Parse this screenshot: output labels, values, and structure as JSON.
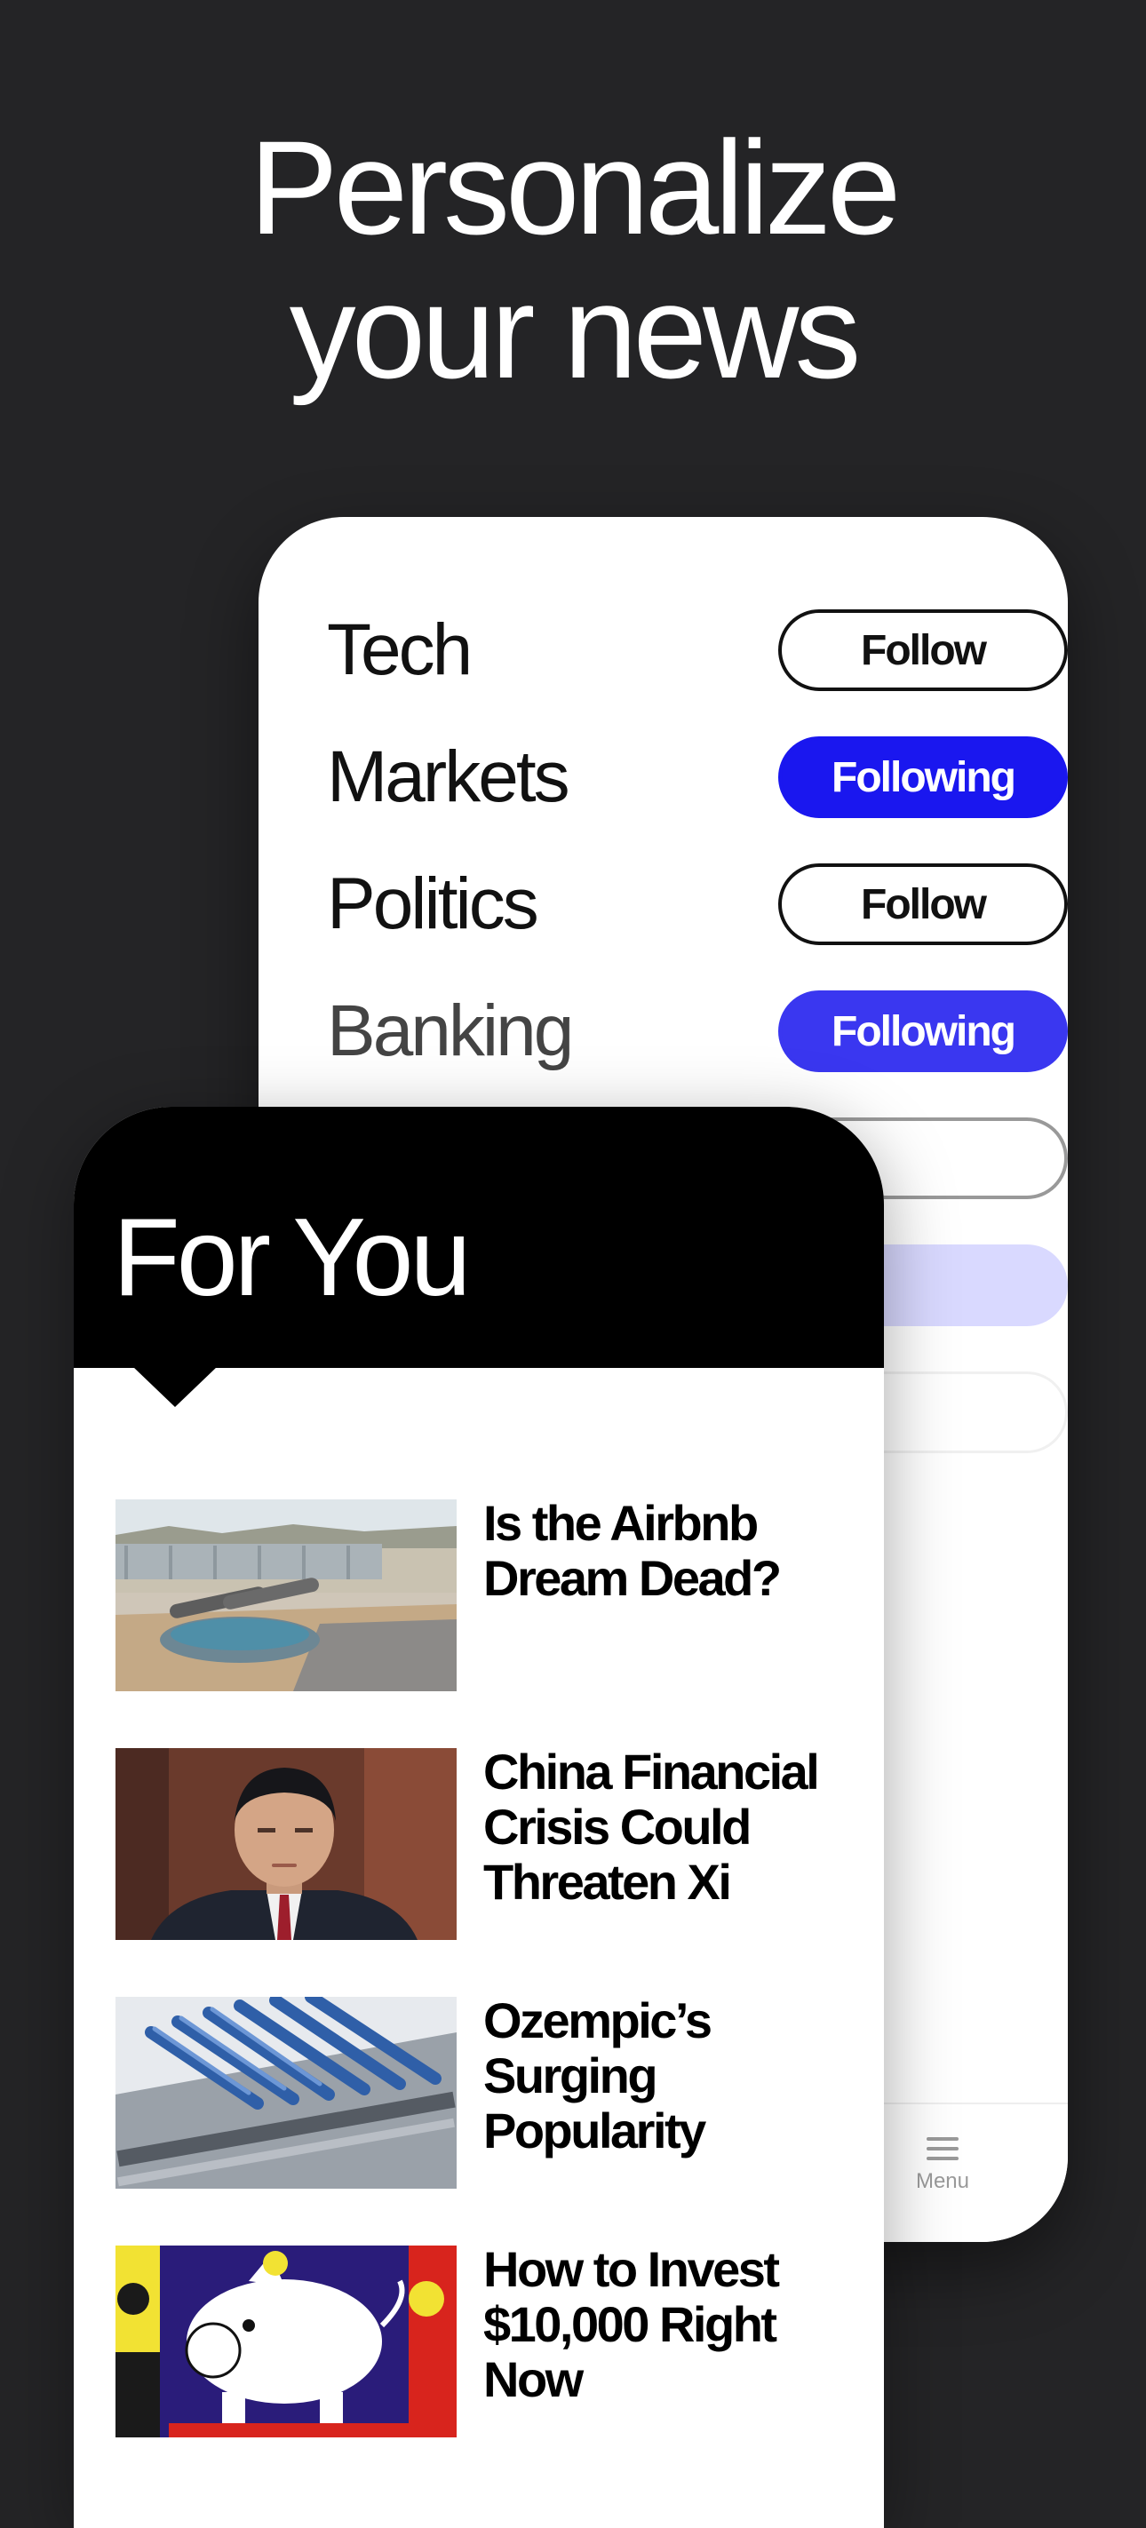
{
  "promo": {
    "headline_line1": "Personalize",
    "headline_line2": "your news"
  },
  "topics": [
    {
      "name": "Tech",
      "button": "Follow",
      "following": false
    },
    {
      "name": "Markets",
      "button": "Following",
      "following": true
    },
    {
      "name": "Politics",
      "button": "Follow",
      "following": false
    },
    {
      "name": "Banking",
      "button": "Following",
      "following": true
    }
  ],
  "bottom_nav": {
    "menu_label": "Menu",
    "menu_icon": "hamburger-menu-icon"
  },
  "feed": {
    "title": "For You",
    "stories": [
      {
        "headline": "Is the Airbnb Dream Dead?",
        "image": "backyard-hot-tub-photo"
      },
      {
        "headline": "China Financial Crisis Could Threaten Xi",
        "image": "xi-jinping-portrait-photo"
      },
      {
        "headline": "Ozempic’s Surging Popularity",
        "image": "injection-pens-production-line-photo"
      },
      {
        "headline": "How to Invest $10,000 Right Now",
        "image": "piggy-bank-illustration"
      }
    ]
  },
  "colors": {
    "background": "#242426",
    "accent_following": "#1a17ef",
    "header": "#000000"
  }
}
